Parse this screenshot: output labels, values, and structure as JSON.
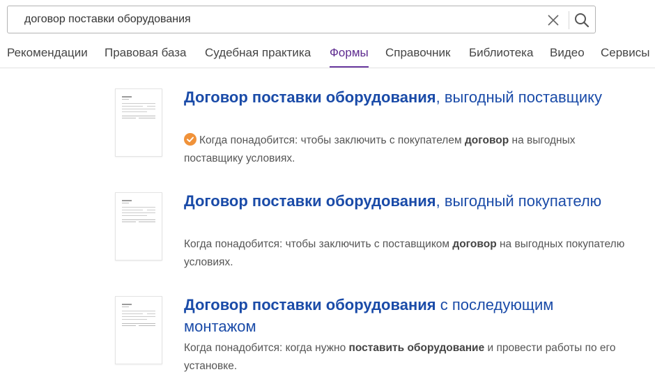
{
  "search": {
    "query": "договор поставки оборудования",
    "clear_icon": "close-icon",
    "search_icon": "search-icon"
  },
  "tabs": [
    {
      "label": "Рекомендации",
      "active": false
    },
    {
      "label": "Правовая база",
      "active": false
    },
    {
      "label": "Судебная практика",
      "active": false
    },
    {
      "label": "Формы",
      "active": true
    },
    {
      "label": "Справочник",
      "active": false
    },
    {
      "label": "Библиотека",
      "active": false
    },
    {
      "label": "Видео",
      "active": false
    },
    {
      "label": "Сервисы",
      "active": false
    }
  ],
  "results": [
    {
      "title_bold": "Договор поставки оборудования",
      "title_rest": ", выгодный поставщику",
      "verified": true,
      "desc_prefix": "Когда понадобится: чтобы заключить с покупателем ",
      "desc_bold": "договор",
      "desc_suffix": " на выгодных поставщику условиях."
    },
    {
      "title_bold": "Договор поставки оборудования",
      "title_rest": ", выгодный покупателю",
      "verified": false,
      "desc_prefix": "Когда понадобится: чтобы заключить с поставщиком ",
      "desc_bold": "договор",
      "desc_suffix": " на выгодных покупателю условиях."
    },
    {
      "title_bold": "Договор поставки оборудования",
      "title_rest": " с последующим монтажом",
      "verified": false,
      "desc_prefix": "Когда понадобится: когда нужно ",
      "desc_bold": "поставить оборудование",
      "desc_suffix": " и провести работы по его установке."
    }
  ],
  "colors": {
    "accent": "#6a3aa0",
    "link": "#1a4ba8",
    "verified": "#f0923a"
  }
}
